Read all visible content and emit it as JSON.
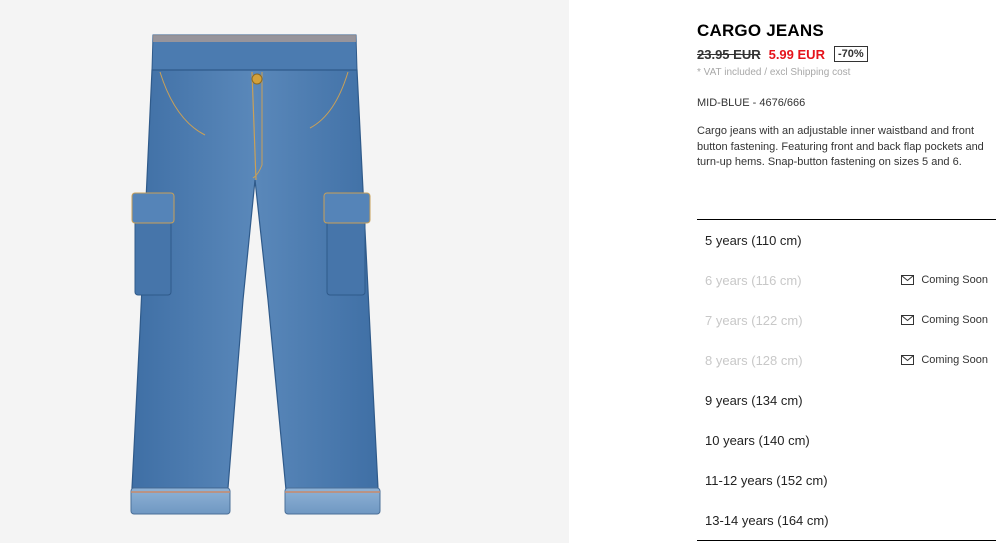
{
  "product": {
    "title": "CARGO JEANS",
    "old_price": "23.95 EUR",
    "new_price": "5.99 EUR",
    "discount": "-70%",
    "vat_note": "* VAT included / excl Shipping cost",
    "color_ref": "MID-BLUE - 4676/666",
    "description": "Cargo jeans with an adjustable inner waistband and front button fastening. Featuring front and back flap pockets and turn-up hems. Snap-button fastening on sizes 5 and 6."
  },
  "sizes": [
    {
      "label": "5 years (110 cm)",
      "available": true,
      "status": ""
    },
    {
      "label": "6 years (116 cm)",
      "available": false,
      "status": "Coming Soon"
    },
    {
      "label": "7 years (122 cm)",
      "available": false,
      "status": "Coming Soon"
    },
    {
      "label": "8 years (128 cm)",
      "available": false,
      "status": "Coming Soon"
    },
    {
      "label": "9 years (134 cm)",
      "available": true,
      "status": ""
    },
    {
      "label": "10 years (140 cm)",
      "available": true,
      "status": ""
    },
    {
      "label": "11-12 years (152 cm)",
      "available": true,
      "status": ""
    },
    {
      "label": "13-14 years (164 cm)",
      "available": true,
      "status": ""
    }
  ],
  "icons": {
    "coming_soon": "envelope-icon"
  },
  "colors": {
    "sale": "#e5131b",
    "unavailable": "#c8c8c8",
    "denim": "#4a79ad"
  }
}
